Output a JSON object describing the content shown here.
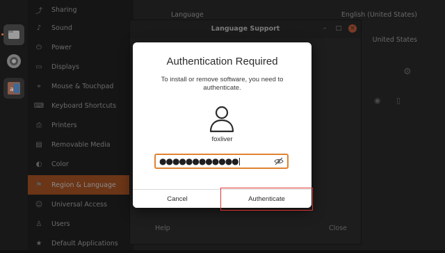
{
  "dock": {
    "apps": [
      {
        "icon": "files-icon"
      },
      {
        "icon": "disc-icon"
      },
      {
        "icon": "software-icon"
      }
    ]
  },
  "settings": {
    "sidebar": {
      "items": [
        {
          "label": "Sharing",
          "icon": "share-icon"
        },
        {
          "label": "Sound",
          "icon": "speaker-icon"
        },
        {
          "label": "Power",
          "icon": "power-icon"
        },
        {
          "label": "Displays",
          "icon": "display-icon"
        },
        {
          "label": "Mouse & Touchpad",
          "icon": "mouse-icon"
        },
        {
          "label": "Keyboard Shortcuts",
          "icon": "keyboard-icon"
        },
        {
          "label": "Printers",
          "icon": "printer-icon"
        },
        {
          "label": "Removable Media",
          "icon": "media-icon"
        },
        {
          "label": "Color",
          "icon": "color-icon"
        },
        {
          "label": "Region & Language",
          "icon": "region-icon",
          "active": true
        },
        {
          "label": "Universal Access",
          "icon": "accessibility-icon"
        },
        {
          "label": "Users",
          "icon": "users-icon"
        },
        {
          "label": "Default Applications",
          "icon": "star-icon"
        }
      ]
    },
    "main": {
      "language_label": "Language",
      "language_value": "English (United States)",
      "formats_value": "United States"
    }
  },
  "language_support": {
    "title": "Language Support",
    "help_label": "Help",
    "close_label": "Close"
  },
  "auth_dialog": {
    "title": "Authentication Required",
    "message": "To install or remove software, you need to authenticate.",
    "username": "foxliver",
    "password_mask": "●●●●●●●●●●●●",
    "cancel_label": "Cancel",
    "authenticate_label": "Authenticate"
  },
  "colors": {
    "accent": "#e0822f",
    "active_sidebar": "#6b3517",
    "highlight_box": "#dd3333"
  }
}
